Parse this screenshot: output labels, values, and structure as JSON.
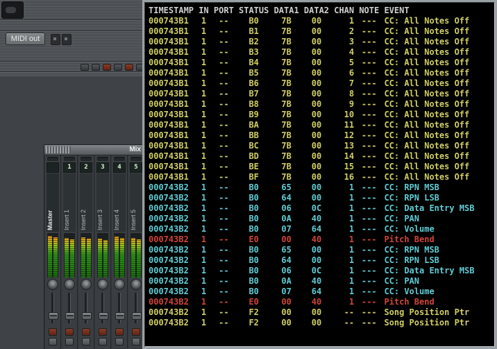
{
  "left_panel": {
    "midi_out_button": "MIDI out",
    "mixer": {
      "title": "Mix",
      "channels": [
        {
          "name": "Master",
          "slot": "",
          "level": 93
        },
        {
          "name": "Insert 1",
          "slot": "1",
          "level": 89
        },
        {
          "name": "Insert 2",
          "slot": "2",
          "level": 91
        },
        {
          "name": "Insert 3",
          "slot": "3",
          "level": 87
        },
        {
          "name": "Insert 4",
          "slot": "4",
          "level": 92
        },
        {
          "name": "Insert 5",
          "slot": "5",
          "level": 89
        }
      ]
    }
  },
  "monitor": {
    "columns": [
      "TIMESTAMP",
      "IN",
      "PORT",
      "STATUS",
      "DATA1",
      "DATA2",
      "CHAN",
      "NOTE",
      "EVENT"
    ],
    "colors": {
      "header": "#cfcfcf",
      "yellow": "#d0ce62",
      "cyan": "#5fccd4",
      "red": "#d04438"
    },
    "rows": [
      [
        "000743B1",
        "1",
        "--",
        "B0",
        "7B",
        "00",
        "1",
        "---",
        "CC: All Notes Off",
        "yellow"
      ],
      [
        "000743B1",
        "1",
        "--",
        "B1",
        "7B",
        "00",
        "2",
        "---",
        "CC: All Notes Off",
        "yellow"
      ],
      [
        "000743B1",
        "1",
        "--",
        "B2",
        "7B",
        "00",
        "3",
        "---",
        "CC: All Notes Off",
        "yellow"
      ],
      [
        "000743B1",
        "1",
        "--",
        "B3",
        "7B",
        "00",
        "4",
        "---",
        "CC: All Notes Off",
        "yellow"
      ],
      [
        "000743B1",
        "1",
        "--",
        "B4",
        "7B",
        "00",
        "5",
        "---",
        "CC: All Notes Off",
        "yellow"
      ],
      [
        "000743B1",
        "1",
        "--",
        "B5",
        "7B",
        "00",
        "6",
        "---",
        "CC: All Notes Off",
        "yellow"
      ],
      [
        "000743B1",
        "1",
        "--",
        "B6",
        "7B",
        "00",
        "7",
        "---",
        "CC: All Notes Off",
        "yellow"
      ],
      [
        "000743B1",
        "1",
        "--",
        "B7",
        "7B",
        "00",
        "8",
        "---",
        "CC: All Notes Off",
        "yellow"
      ],
      [
        "000743B1",
        "1",
        "--",
        "B8",
        "7B",
        "00",
        "9",
        "---",
        "CC: All Notes Off",
        "yellow"
      ],
      [
        "000743B1",
        "1",
        "--",
        "B9",
        "7B",
        "00",
        "10",
        "---",
        "CC: All Notes Off",
        "yellow"
      ],
      [
        "000743B1",
        "1",
        "--",
        "BA",
        "7B",
        "00",
        "11",
        "---",
        "CC: All Notes Off",
        "yellow"
      ],
      [
        "000743B1",
        "1",
        "--",
        "BB",
        "7B",
        "00",
        "12",
        "---",
        "CC: All Notes Off",
        "yellow"
      ],
      [
        "000743B1",
        "1",
        "--",
        "BC",
        "7B",
        "00",
        "13",
        "---",
        "CC: All Notes Off",
        "yellow"
      ],
      [
        "000743B1",
        "1",
        "--",
        "BD",
        "7B",
        "00",
        "14",
        "---",
        "CC: All Notes Off",
        "yellow"
      ],
      [
        "000743B1",
        "1",
        "--",
        "BE",
        "7B",
        "00",
        "15",
        "---",
        "CC: All Notes Off",
        "yellow"
      ],
      [
        "000743B1",
        "1",
        "--",
        "BF",
        "7B",
        "00",
        "16",
        "---",
        "CC: All Notes Off",
        "yellow"
      ],
      [
        "000743B2",
        "1",
        "--",
        "B0",
        "65",
        "00",
        "1",
        "---",
        "CC: RPN MSB",
        "cyan"
      ],
      [
        "000743B2",
        "1",
        "--",
        "B0",
        "64",
        "00",
        "1",
        "---",
        "CC: RPN LSB",
        "cyan"
      ],
      [
        "000743B2",
        "1",
        "--",
        "B0",
        "06",
        "0C",
        "1",
        "---",
        "CC: Data Entry MSB",
        "cyan"
      ],
      [
        "000743B2",
        "1",
        "--",
        "B0",
        "0A",
        "40",
        "1",
        "---",
        "CC: PAN",
        "cyan"
      ],
      [
        "000743B2",
        "1",
        "--",
        "B0",
        "07",
        "64",
        "1",
        "---",
        "CC: Volume",
        "cyan"
      ],
      [
        "000743B2",
        "1",
        "--",
        "E0",
        "00",
        "40",
        "1",
        "---",
        "Pitch Bend",
        "red"
      ],
      [
        "000743B2",
        "1",
        "--",
        "B0",
        "65",
        "00",
        "1",
        "---",
        "CC: RPN MSB",
        "cyan"
      ],
      [
        "000743B2",
        "1",
        "--",
        "B0",
        "64",
        "00",
        "1",
        "---",
        "CC: RPN LSB",
        "cyan"
      ],
      [
        "000743B2",
        "1",
        "--",
        "B0",
        "06",
        "0C",
        "1",
        "---",
        "CC: Data Entry MSB",
        "cyan"
      ],
      [
        "000743B2",
        "1",
        "--",
        "B0",
        "0A",
        "40",
        "1",
        "---",
        "CC: PAN",
        "cyan"
      ],
      [
        "000743B2",
        "1",
        "--",
        "B0",
        "07",
        "64",
        "1",
        "---",
        "CC: Volume",
        "cyan"
      ],
      [
        "000743B2",
        "1",
        "--",
        "E0",
        "00",
        "40",
        "1",
        "---",
        "Pitch Bend",
        "red"
      ],
      [
        "000743B2",
        "1",
        "--",
        "F2",
        "00",
        "00",
        "--",
        "---",
        "Song Position Ptr",
        "yellow"
      ],
      [
        "000743B2",
        "1",
        "--",
        "F2",
        "00",
        "00",
        "--",
        "---",
        "Song Position Ptr",
        "yellow"
      ]
    ]
  }
}
